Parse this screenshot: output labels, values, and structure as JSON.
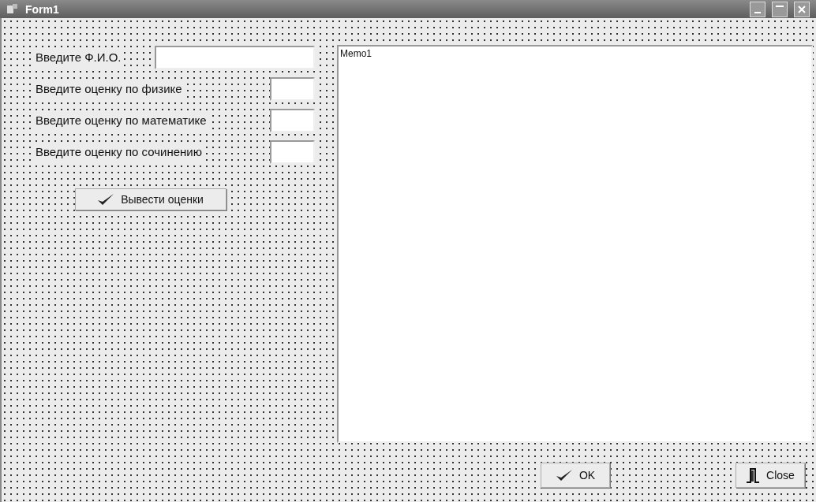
{
  "window": {
    "title": "Form1"
  },
  "fields": [
    {
      "label": "Введите Ф.И.О.",
      "kind": "wide"
    },
    {
      "label": "Введите оценку по физике",
      "kind": "narrow"
    },
    {
      "label": "Введите оценку по математике",
      "kind": "narrow"
    },
    {
      "label": "Введите оценку по сочинению",
      "kind": "narrow"
    }
  ],
  "action_button": {
    "label": "Вывести оценки"
  },
  "memo": {
    "value": "Memo1"
  },
  "buttons": [
    {
      "label": "OK",
      "kind": "ok"
    },
    {
      "label": "Close",
      "kind": "close"
    }
  ]
}
